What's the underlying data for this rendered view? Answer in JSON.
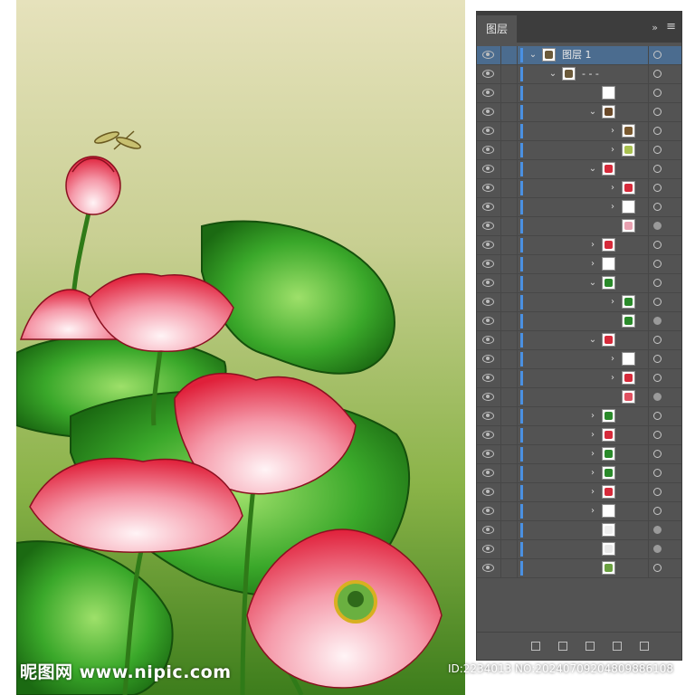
{
  "watermark": {
    "site": "昵图网 www.nipic.com",
    "id_text": "ID:2234013 NO:20240709204809886108"
  },
  "panel": {
    "tab_label": "图层",
    "collapse_icon": "double-chevron-right-icon",
    "menu_icon": "hamburger-menu-icon"
  },
  "layers": [
    {
      "label": "图层 1",
      "indent": 0,
      "chevron": "down",
      "thumb": "#6b5a3a",
      "selected": true,
      "target": "empty"
    },
    {
      "label": "- - -",
      "indent": 1,
      "chevron": "down",
      "thumb": "#6b5a3a",
      "selected": false,
      "target": "empty"
    },
    {
      "label": "",
      "indent": 3,
      "chevron": "none",
      "thumb": "#ffffff",
      "selected": false,
      "target": "empty"
    },
    {
      "label": "",
      "indent": 3,
      "chevron": "down",
      "thumb": "#6b4a2a",
      "selected": false,
      "target": "empty"
    },
    {
      "label": "",
      "indent": 4,
      "chevron": "right",
      "thumb": "#7a5a30",
      "selected": false,
      "target": "empty"
    },
    {
      "label": "",
      "indent": 4,
      "chevron": "right",
      "thumb": "#a8c050",
      "selected": false,
      "target": "empty"
    },
    {
      "label": "",
      "indent": 3,
      "chevron": "down",
      "thumb": "#d62a3a",
      "selected": false,
      "target": "empty"
    },
    {
      "label": "",
      "indent": 4,
      "chevron": "right",
      "thumb": "#d62a3a",
      "selected": false,
      "target": "empty"
    },
    {
      "label": "",
      "indent": 4,
      "chevron": "right",
      "thumb": "#ffffff",
      "selected": false,
      "target": "empty"
    },
    {
      "label": "",
      "indent": 4,
      "chevron": "none",
      "thumb": "#e8a0b0",
      "selected": false,
      "target": "filled"
    },
    {
      "label": "",
      "indent": 3,
      "chevron": "right",
      "thumb": "#d62a3a",
      "selected": false,
      "target": "empty"
    },
    {
      "label": "",
      "indent": 3,
      "chevron": "right",
      "thumb": "#ffffff",
      "selected": false,
      "target": "empty"
    },
    {
      "label": "",
      "indent": 3,
      "chevron": "down",
      "thumb": "#2a8a2a",
      "selected": false,
      "target": "empty"
    },
    {
      "label": "",
      "indent": 4,
      "chevron": "right",
      "thumb": "#2a8a2a",
      "selected": false,
      "target": "empty"
    },
    {
      "label": "",
      "indent": 4,
      "chevron": "none",
      "thumb": "#2a8a2a",
      "selected": false,
      "target": "filled"
    },
    {
      "label": "",
      "indent": 3,
      "chevron": "down",
      "thumb": "#d62a3a",
      "selected": false,
      "target": "empty"
    },
    {
      "label": "",
      "indent": 4,
      "chevron": "right",
      "thumb": "#ffffff",
      "selected": false,
      "target": "empty"
    },
    {
      "label": "",
      "indent": 4,
      "chevron": "right",
      "thumb": "#d62a3a",
      "selected": false,
      "target": "empty"
    },
    {
      "label": "",
      "indent": 4,
      "chevron": "none",
      "thumb": "#e05060",
      "selected": false,
      "target": "filled"
    },
    {
      "label": "",
      "indent": 3,
      "chevron": "right",
      "thumb": "#2a8a2a",
      "selected": false,
      "target": "empty"
    },
    {
      "label": "",
      "indent": 3,
      "chevron": "right",
      "thumb": "#d62a3a",
      "selected": false,
      "target": "empty"
    },
    {
      "label": "",
      "indent": 3,
      "chevron": "right",
      "thumb": "#2a8a2a",
      "selected": false,
      "target": "empty"
    },
    {
      "label": "",
      "indent": 3,
      "chevron": "right",
      "thumb": "#2a8a2a",
      "selected": false,
      "target": "empty"
    },
    {
      "label": "",
      "indent": 3,
      "chevron": "right",
      "thumb": "#d62a3a",
      "selected": false,
      "target": "empty"
    },
    {
      "label": "",
      "indent": 3,
      "chevron": "right",
      "thumb": "#ffffff",
      "selected": false,
      "target": "empty"
    },
    {
      "label": "",
      "indent": 3,
      "chevron": "none",
      "thumb": "#eeeeee",
      "selected": false,
      "target": "filled"
    },
    {
      "label": "",
      "indent": 3,
      "chevron": "none",
      "thumb": "#e8e8e8",
      "selected": false,
      "target": "filled"
    },
    {
      "label": "",
      "indent": 3,
      "chevron": "none",
      "thumb": "#6aa040",
      "selected": false,
      "target": "empty"
    }
  ],
  "colors": {
    "panel_bg": "#535353",
    "selected_row": "#4b6c8f",
    "layer_color_bar": "#4a90e2",
    "canvas_top": "#e6e2bc",
    "canvas_bottom": "#5a9a2a"
  }
}
